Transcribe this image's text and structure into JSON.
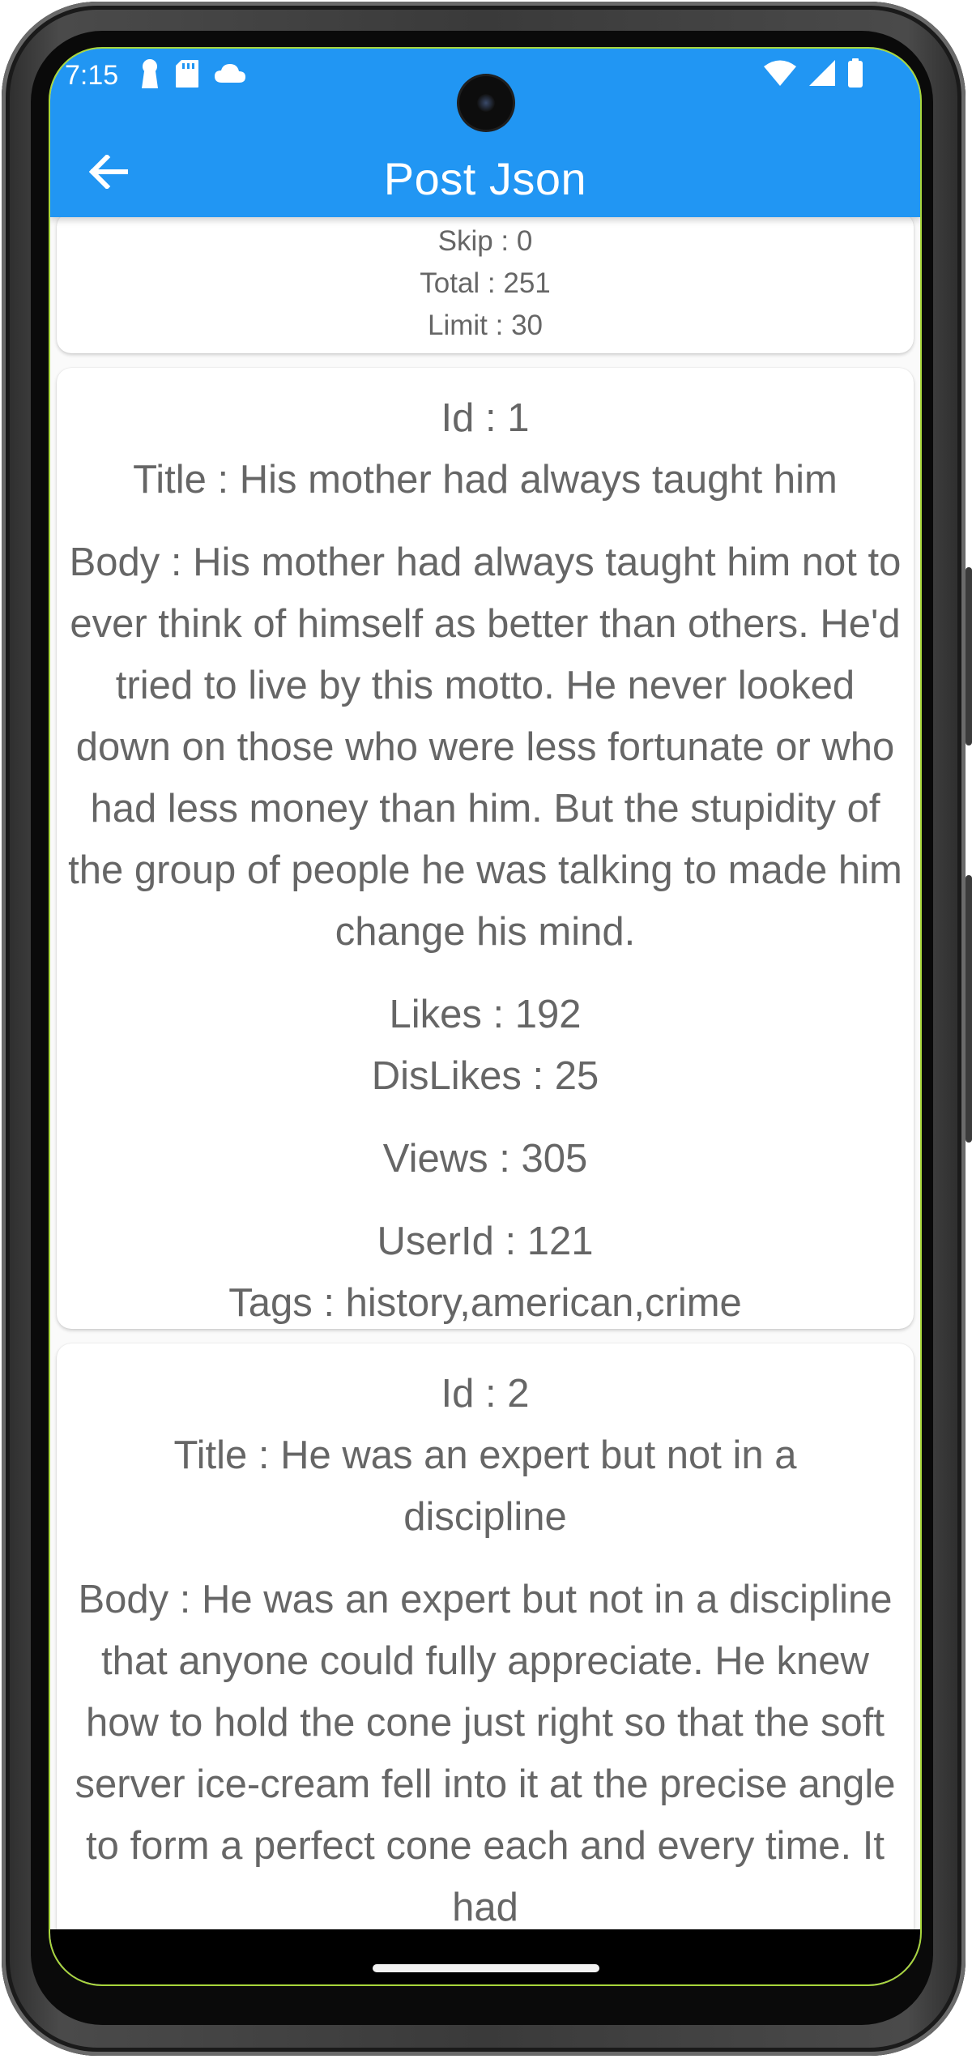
{
  "status_bar": {
    "time": "7:15",
    "left_icons": [
      "keyhole-icon",
      "sd-card-icon",
      "cloud-icon"
    ],
    "right_icons": [
      "wifi-icon",
      "signal-icon",
      "battery-icon"
    ]
  },
  "app_bar": {
    "title": "Post Json",
    "back_icon": "arrow-left-icon",
    "color": "#2196f3"
  },
  "meta": {
    "skip": "Skip : 0",
    "total": "Total : 251",
    "limit": "Limit : 30"
  },
  "posts": [
    {
      "id": "Id : 1",
      "title": "Title : His mother had always taught him",
      "body": "Body : His mother had always taught him not to ever think of himself as better than others. He'd tried to live by this motto. He never looked down on those who were less fortunate or who had less money than him. But the stupidity of the group of people he was talking to made him change his mind.",
      "likes": "Likes : 192",
      "dislikes": "DisLikes : 25",
      "views": "Views : 305",
      "user_id": "UserId : 121",
      "tags": "Tags : history,american,crime"
    },
    {
      "id": "Id : 2",
      "title": "Title : He was an expert but not in a discipline",
      "body": "Body : He was an expert but not in a discipline that anyone could fully appreciate. He knew how to hold the cone just right so that the soft server ice-cream fell into it at the precise angle to form a perfect cone each and every time. It had"
    }
  ]
}
